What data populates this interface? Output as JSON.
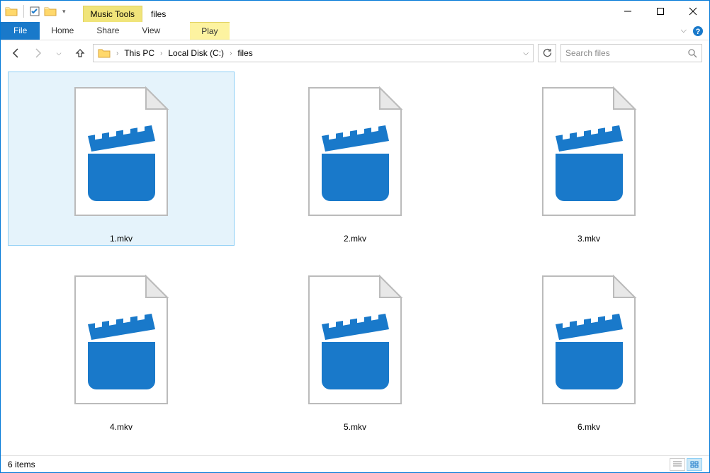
{
  "window": {
    "title": "files",
    "contextual_tab": "Music Tools"
  },
  "ribbon": {
    "file": "File",
    "home": "Home",
    "share": "Share",
    "view": "View",
    "play": "Play"
  },
  "breadcrumbs": {
    "root": "This PC",
    "drive": "Local Disk (C:)",
    "folder": "files"
  },
  "search": {
    "placeholder": "Search files"
  },
  "files": [
    {
      "name": "1.mkv",
      "selected": true
    },
    {
      "name": "2.mkv",
      "selected": false
    },
    {
      "name": "3.mkv",
      "selected": false
    },
    {
      "name": "4.mkv",
      "selected": false
    },
    {
      "name": "5.mkv",
      "selected": false
    },
    {
      "name": "6.mkv",
      "selected": false
    }
  ],
  "status": {
    "count": "6 items"
  }
}
